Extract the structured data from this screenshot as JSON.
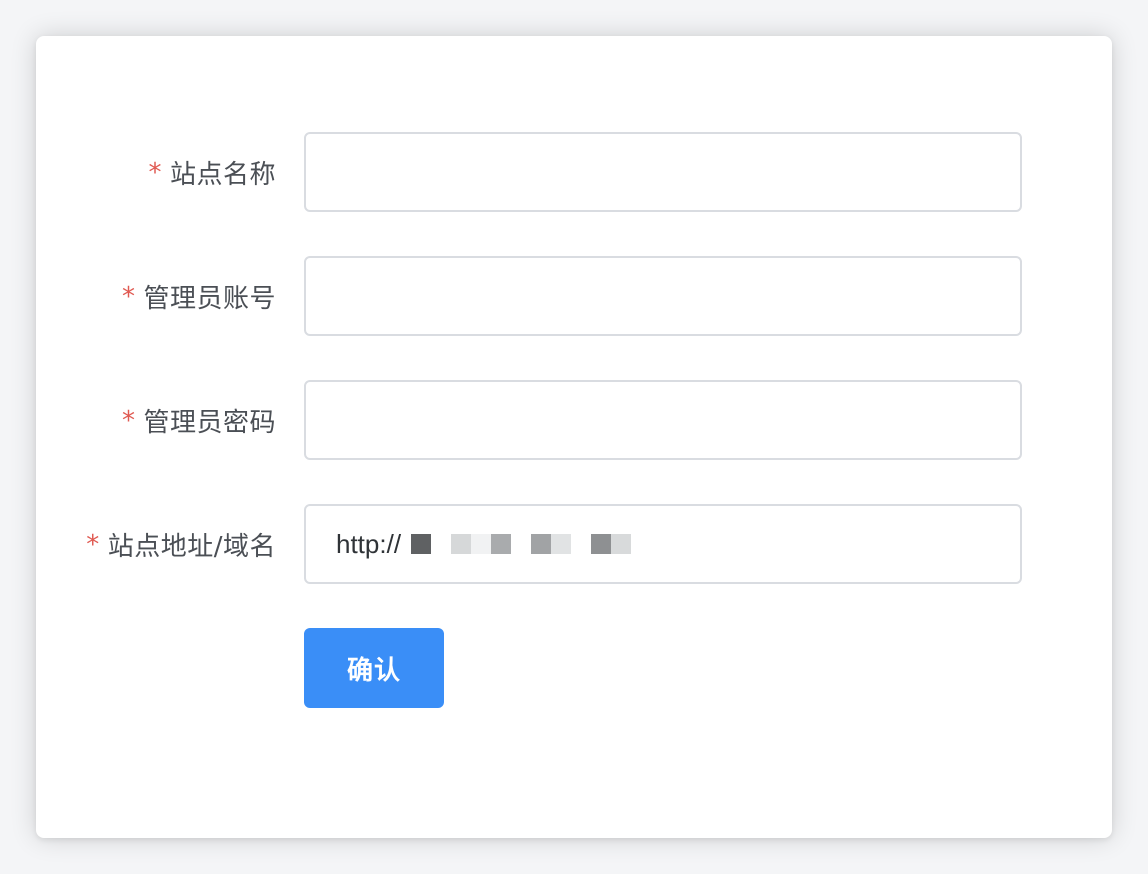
{
  "form": {
    "fields": [
      {
        "required_mark": "*",
        "label": "站点名称",
        "value": ""
      },
      {
        "required_mark": "*",
        "label": "管理员账号",
        "value": ""
      },
      {
        "required_mark": "*",
        "label": "管理员密码",
        "value": ""
      },
      {
        "required_mark": "*",
        "label": "站点地址/域名",
        "value": "http://"
      }
    ],
    "submit_label": "确认"
  },
  "colors": {
    "required": "#e05a52",
    "primary": "#3a8ef7",
    "border": "#d9dce1",
    "label": "#4b4f55"
  }
}
